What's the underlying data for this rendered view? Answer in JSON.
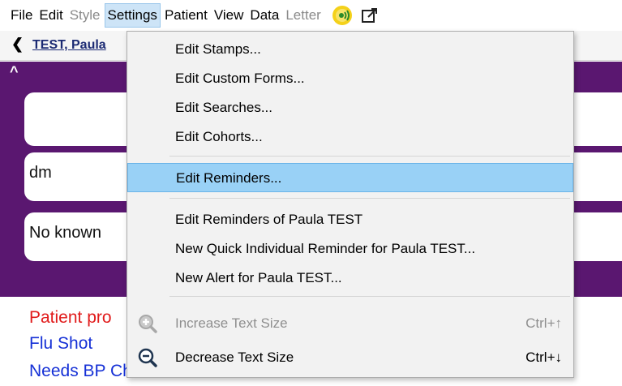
{
  "menubar": {
    "items": [
      "File",
      "Edit",
      "Style",
      "Settings",
      "Patient",
      "View",
      "Data",
      "Letter"
    ],
    "disabled": [
      "Style",
      "Letter"
    ],
    "active": "Settings"
  },
  "patient": {
    "name": "TEST, Paula"
  },
  "cards": {
    "card2_text": "dm",
    "card3_text": "No known"
  },
  "reminders": [
    "Patient pro",
    "Flu Shot",
    "Needs BP Check"
  ],
  "settings_menu": {
    "items": [
      {
        "label": "Edit Stamps..."
      },
      {
        "label": "Edit Custom Forms..."
      },
      {
        "label": "Edit Searches..."
      },
      {
        "label": "Edit Cohorts..."
      },
      {
        "label": "Edit Reminders..."
      },
      {
        "label": "Edit Reminders of Paula TEST"
      },
      {
        "label": "New Quick Individual Reminder for Paula TEST..."
      },
      {
        "label": "New Alert for Paula TEST..."
      },
      {
        "label": "Increase Text Size",
        "shortcut": "Ctrl+↑",
        "icon": "zoom-in-icon",
        "disabled": true
      },
      {
        "label": "Decrease Text Size",
        "shortcut": "Ctrl+↓",
        "icon": "zoom-out-icon"
      }
    ],
    "highlighted": "Edit Reminders..."
  },
  "colors": {
    "panel_purple": "#5a1770",
    "menu_highlight": "#99d1f6",
    "patient_link": "#1b2a73"
  }
}
